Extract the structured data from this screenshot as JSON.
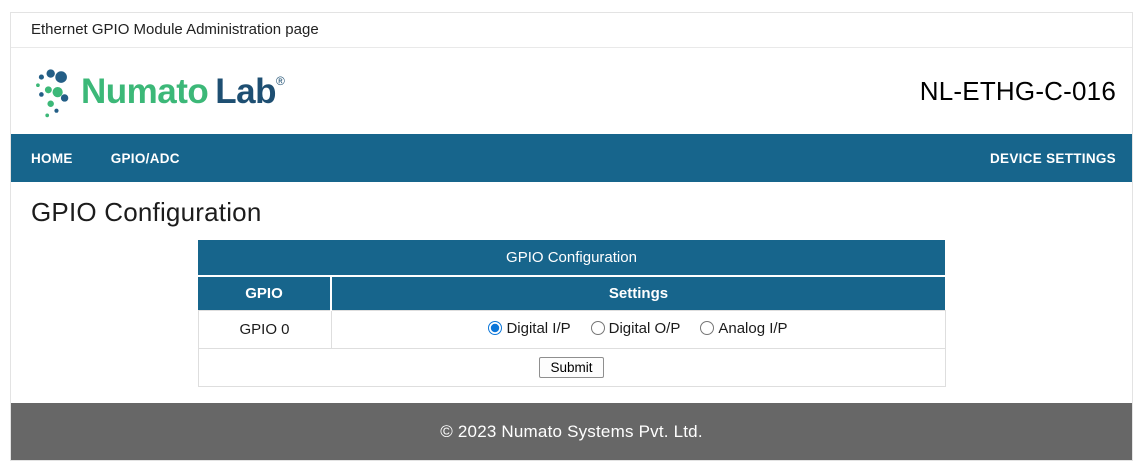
{
  "topbar": {
    "title": "Ethernet GPIO Module Administration page"
  },
  "header": {
    "brand_primary": "Numato",
    "brand_secondary": "Lab",
    "registered_mark": "®",
    "model_number": "NL-ETHG-C-016",
    "brand_green": "#3cb878",
    "brand_blue": "#1e4f72"
  },
  "nav": {
    "background": "#17658c",
    "items_left": [
      {
        "label": "HOME"
      },
      {
        "label": "GPIO/ADC"
      }
    ],
    "items_right": [
      {
        "label": "DEVICE SETTINGS"
      }
    ]
  },
  "main": {
    "page_title": "GPIO Configuration",
    "table": {
      "title": "GPIO Configuration",
      "header_background": "#17658c",
      "columns": [
        "GPIO",
        "Settings"
      ],
      "rows": [
        {
          "gpio": "GPIO 0",
          "options": [
            {
              "label": "Digital I/P",
              "selected": true
            },
            {
              "label": "Digital O/P",
              "selected": false
            },
            {
              "label": "Analog I/P",
              "selected": false
            }
          ]
        }
      ],
      "submit_label": "Submit"
    }
  },
  "footer": {
    "text": "© 2023 Numato Systems Pvt. Ltd.",
    "background": "#676767"
  }
}
